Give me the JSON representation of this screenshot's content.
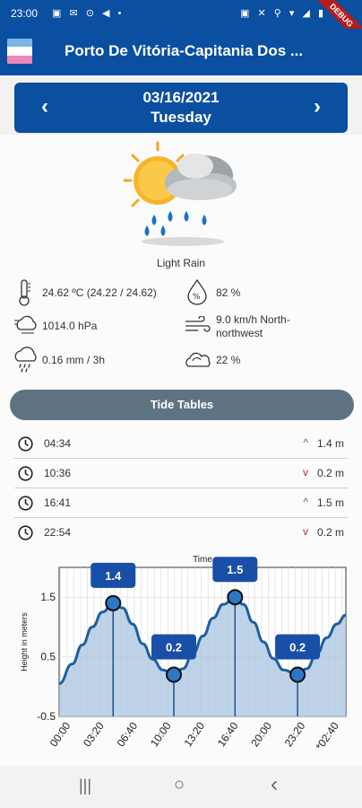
{
  "status_bar": {
    "time": "23:00",
    "left_icons": "▣ ✉ ⊙ ◀ •",
    "right_icons": "▣ ✕ ⚲ ▾ ◢ ▮",
    "debug_label": "DEBUG"
  },
  "app_bar": {
    "title": "Porto De Vitória-Capitania Dos ...",
    "flag_icon": "port-flag-icon"
  },
  "date_nav": {
    "date": "03/16/2021",
    "day": "Tuesday",
    "prev_glyph": "‹",
    "next_glyph": "›"
  },
  "weather": {
    "icon": "cloud-sun-rain-icon",
    "condition": "Light Rain",
    "temperature": "24.62 ºC (24.22 / 24.62)",
    "humidity": "82 %",
    "pressure": "1014.0 hPa",
    "wind_line1": "9.0 km/h North-",
    "wind_line2": "northwest",
    "rain": "0.16 mm  / 3h",
    "clouds": "22 %"
  },
  "tide_tables": {
    "button_label": "Tide Tables",
    "rows": [
      {
        "time": "04:34",
        "trend": "up",
        "trend_glyph": "^",
        "height": "1.4 m"
      },
      {
        "time": "10:36",
        "trend": "down",
        "trend_glyph": "v",
        "height": "0.2 m"
      },
      {
        "time": "16:41",
        "trend": "up",
        "trend_glyph": "^",
        "height": "1.5 m"
      },
      {
        "time": "22:54",
        "trend": "down",
        "trend_glyph": "v",
        "height": "0.2 m"
      }
    ]
  },
  "colors": {
    "brand": "#0b4fa0",
    "tide_button": "#5f7482",
    "trend_up": "#2e7d32",
    "trend_down": "#c62828",
    "chart_line": "#1f5f9f",
    "chart_fill": "#a9c4e0"
  },
  "chart_data": {
    "type": "area",
    "title": "Time",
    "xlabel": "",
    "ylabel": "Height in meters",
    "x_tick_labels": [
      "00:00",
      "03:20",
      "06:40",
      "10:00",
      "13:20",
      "16:40",
      "20:00",
      "23:20",
      "*02:40"
    ],
    "x_tick_hours": [
      0,
      3.333,
      6.667,
      10,
      13.333,
      16.667,
      20,
      23.333,
      26.667
    ],
    "xlim_hours": [
      -0.8,
      27.7
    ],
    "ylim": [
      -0.5,
      2.0
    ],
    "y_ticks": [
      1.5,
      0.5,
      -0.5
    ],
    "y_tick_labels": [
      "1.5",
      "0.5",
      "-0.5"
    ],
    "grid": true,
    "series": [
      {
        "x_hours": [
          -0.8,
          0.5,
          1.5,
          2.5,
          3.5,
          4.567,
          5.5,
          6.5,
          7.5,
          8.5,
          9.5,
          10.6,
          11.5,
          12.5,
          13.5,
          14.5,
          15.5,
          16.683,
          17.5,
          18.5,
          19.5,
          20.5,
          21.5,
          22.9,
          23.8,
          24.8,
          25.8,
          26.8,
          27.7
        ],
        "y": [
          0.05,
          0.38,
          0.7,
          1.0,
          1.25,
          1.4,
          1.32,
          1.05,
          0.72,
          0.46,
          0.28,
          0.2,
          0.3,
          0.55,
          0.85,
          1.15,
          1.38,
          1.5,
          1.38,
          1.08,
          0.75,
          0.47,
          0.28,
          0.2,
          0.3,
          0.55,
          0.82,
          1.05,
          1.2
        ]
      }
    ],
    "extrema": [
      {
        "x_hours": 4.567,
        "y": 1.4,
        "label": "1.4"
      },
      {
        "x_hours": 10.6,
        "y": 0.2,
        "label": "0.2"
      },
      {
        "x_hours": 16.683,
        "y": 1.5,
        "label": "1.5"
      },
      {
        "x_hours": 22.9,
        "y": 0.2,
        "label": "0.2"
      }
    ]
  },
  "nav_bar": {
    "recents": "|||",
    "home": "○",
    "back": "‹"
  }
}
